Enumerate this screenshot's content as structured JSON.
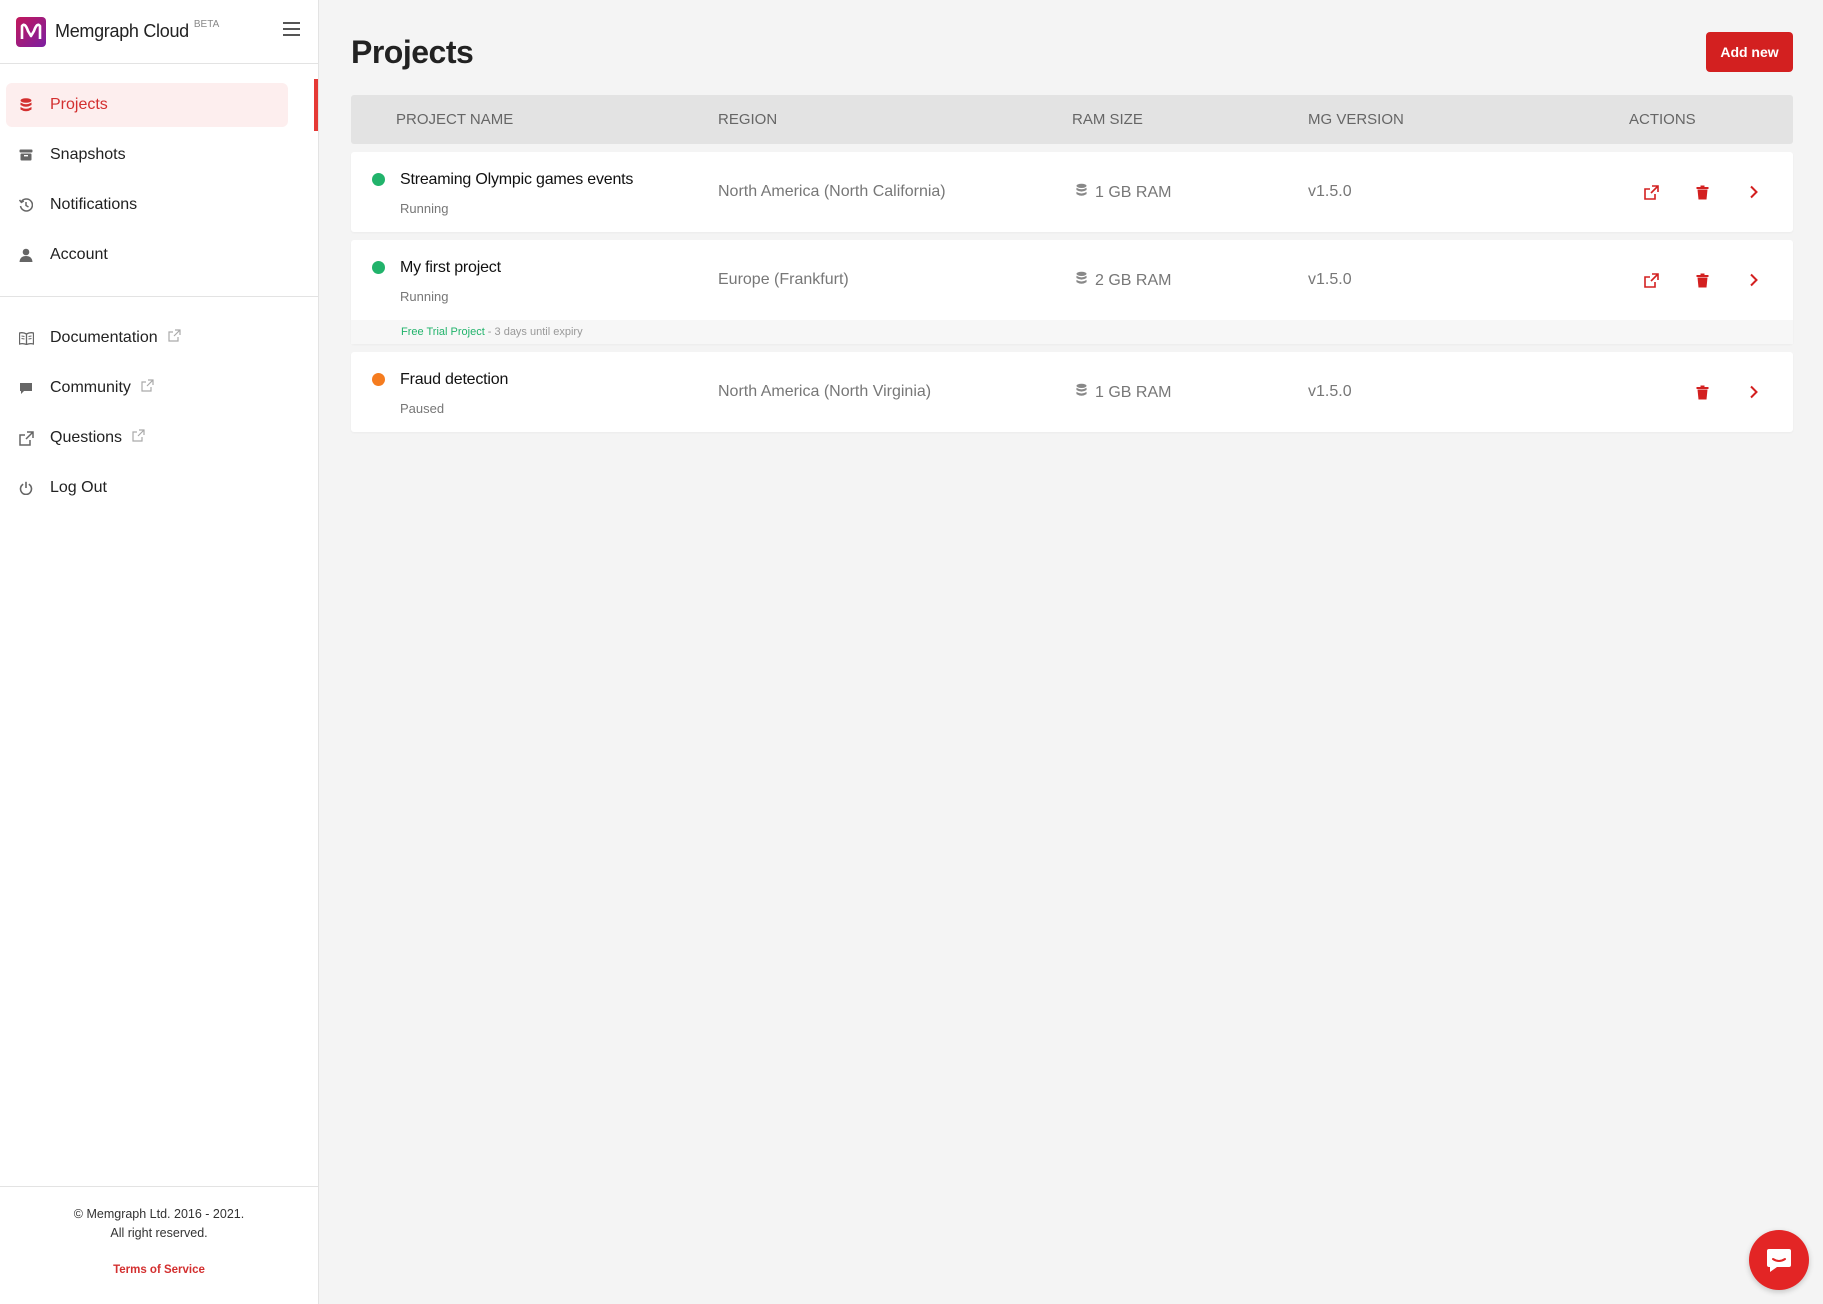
{
  "brand": {
    "name": "Memgraph Cloud",
    "badge": "BETA"
  },
  "nav": {
    "primary": [
      {
        "label": "Projects",
        "icon": "database-icon",
        "active": true
      },
      {
        "label": "Snapshots",
        "icon": "archive-icon",
        "active": false
      },
      {
        "label": "Notifications",
        "icon": "history-icon",
        "active": false
      },
      {
        "label": "Account",
        "icon": "user-icon",
        "active": false
      }
    ],
    "secondary": [
      {
        "label": "Documentation",
        "icon": "book-icon",
        "external": true
      },
      {
        "label": "Community",
        "icon": "chat-icon",
        "external": true
      },
      {
        "label": "Questions",
        "icon": "external-link-icon",
        "external": true
      },
      {
        "label": "Log Out",
        "icon": "power-icon",
        "external": false
      }
    ]
  },
  "footer": {
    "copyright": "© Memgraph Ltd. 2016 - 2021.",
    "rights": "All right reserved.",
    "terms": "Terms of Service"
  },
  "page": {
    "title": "Projects",
    "add_button": "Add new"
  },
  "table": {
    "headers": {
      "name": "PROJECT NAME",
      "region": "REGION",
      "ram": "RAM SIZE",
      "version": "MG VERSION",
      "actions": "ACTIONS"
    },
    "rows": [
      {
        "name": "Streaming Olympic games events",
        "status": "Running",
        "status_color": "#21b36b",
        "region": "North America (North California)",
        "ram": "1 GB RAM",
        "version": "v1.5.0"
      },
      {
        "name": "My first project",
        "status": "Running",
        "status_color": "#21b36b",
        "region": "Europe (Frankfurt)",
        "ram": "2 GB RAM",
        "version": "v1.5.0",
        "trial_label": "Free Trial Project",
        "trial_note": " - 3 days until expiry"
      },
      {
        "name": "Fraud detection",
        "status": "Paused",
        "status_color": "#f57c1f",
        "region": "North America (North Virginia)",
        "ram": "1 GB RAM",
        "version": "v1.5.0"
      }
    ]
  },
  "colors": {
    "accent": "#d32020",
    "running": "#21b36b",
    "paused": "#f57c1f"
  }
}
